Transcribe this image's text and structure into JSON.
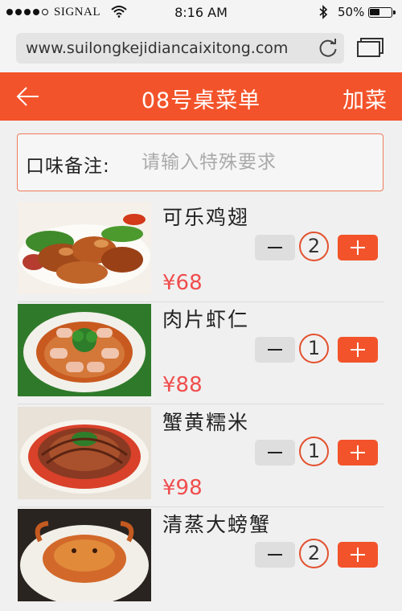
{
  "status_bar": {
    "carrier": "SIGNAL",
    "time": "8:16 AM",
    "battery": "50%",
    "battery_level": 0.5,
    "signal_bars_filled": 4,
    "signal_bars_total": 5
  },
  "browser": {
    "url": "www.suilongkejidiancaixitong.com",
    "reload_icon": "reload-icon",
    "tabs_icon": "tabs-icon"
  },
  "header": {
    "back_icon": "back-arrow-icon",
    "title": "08号桌菜单",
    "add_label": "加菜",
    "color": "#f3532a"
  },
  "note": {
    "label": "口味备注:",
    "placeholder": "请输入特殊要求",
    "value": ""
  },
  "dishes": [
    {
      "name": "可乐鸡翅",
      "price": "¥68",
      "quantity": "2"
    },
    {
      "name": "肉片虾仁",
      "price": "¥88",
      "quantity": "1"
    },
    {
      "name": "蟹黄糯米",
      "price": "¥98",
      "quantity": "1"
    },
    {
      "name": "清蒸大螃蟹",
      "price": "",
      "quantity": "2"
    }
  ],
  "colors": {
    "accent": "#f3532a",
    "price": "#f04d4d"
  }
}
